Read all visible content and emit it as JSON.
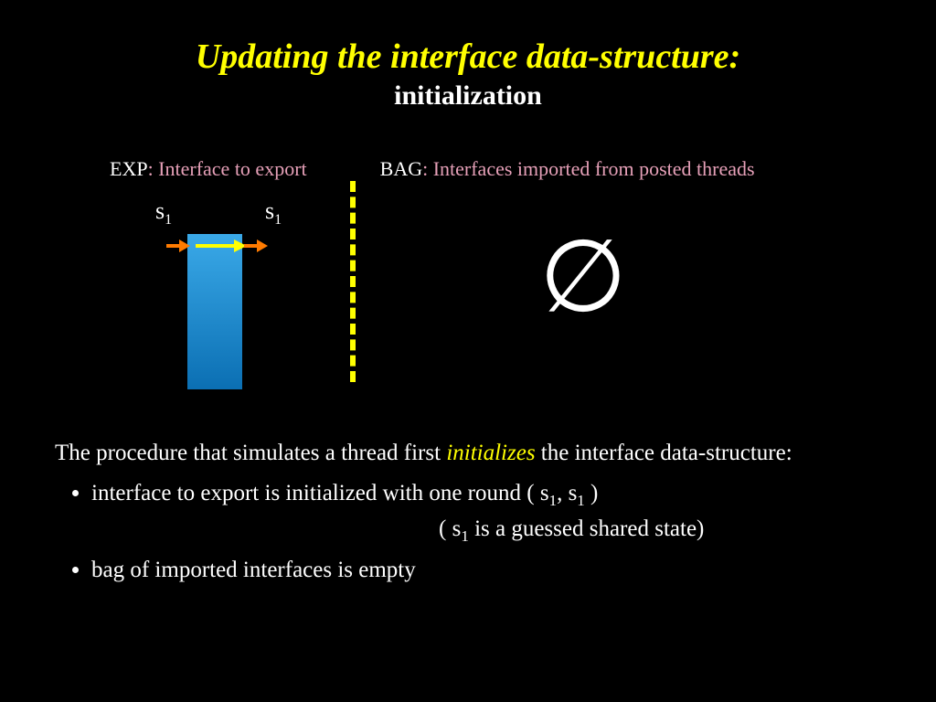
{
  "title": "Updating the interface data-structure:",
  "subtitle": "initialization",
  "exp": {
    "head": "EXP",
    "desc": ": Interface to export"
  },
  "bag": {
    "head": "BAG",
    "desc": ": Interfaces imported from posted threads"
  },
  "s1_left": "s",
  "s1_left_sub": "1",
  "s1_right": "s",
  "s1_right_sub": "1",
  "emptyset": "∅",
  "para_pre": "The procedure that simulates a thread first ",
  "para_em": "initializes",
  "para_post": " the interface data-structure:",
  "bullet1_em": "interface to export",
  "bullet1_rest": "  is initialized with one round  ( s",
  "bullet1_sub1": "1",
  "bullet1_mid": ", s",
  "bullet1_sub2": "1",
  "bullet1_end": " )",
  "aside_pre": "(  s",
  "aside_sub": "1",
  "aside_post": " is a  guessed shared state)",
  "bullet2_pre": "bag of ",
  "bullet2_em": "imported interfaces",
  "bullet2_post": " is empty"
}
